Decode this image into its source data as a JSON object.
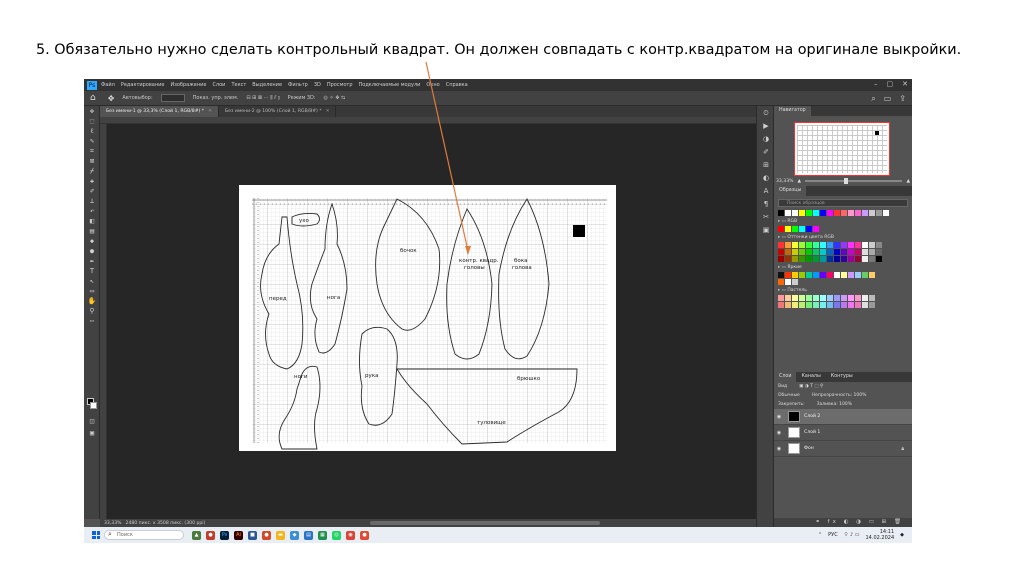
{
  "caption": "5. Обязательно нужно сделать контрольный квадрат. Он должен совпадать с контр.квадратом на оригинале выкройки.",
  "app": {
    "logo": "Ps",
    "menu": [
      "Файл",
      "Редактирование",
      "Изображение",
      "Слои",
      "Текст",
      "Выделение",
      "Фильтр",
      "3D",
      "Просмотр",
      "Подключаемые модули",
      "Окно",
      "Справка"
    ],
    "window_controls": [
      "–",
      "▢",
      "✕"
    ]
  },
  "options_bar": {
    "items": [
      "Автовыбор:",
      "Слой",
      "Показ. упр. элем."
    ],
    "mode_label": "Режим 3D:"
  },
  "doc_tabs": [
    {
      "label": "Без имени-1 @ 33,3% (Слой 1, RGB/8#) *",
      "active": true
    },
    {
      "label": "Без имени-2 @ 100% (Слой 1, RGB/8#) *",
      "active": false
    }
  ],
  "status": {
    "zoom": "33,33%",
    "doc": "2480 пикс. x 3508 пикс. (300 ppi)"
  },
  "panels": {
    "navigator": {
      "tabs": [
        "Навигатор"
      ],
      "zoom": "33,33%"
    },
    "swatches": {
      "tabs": [
        "Образцы"
      ],
      "search": "Поиск образцов",
      "groups": [
        "RGB",
        "Оттенки цвета RGB",
        "Яркие",
        "Пастель"
      ]
    },
    "layers": {
      "tabs": [
        "Слои",
        "Каналы",
        "Контуры"
      ],
      "kind_label": "Вид",
      "blend_mode": "Обычные",
      "opacity": "Непрозрачность: 100%",
      "lock_label": "Закрепить:",
      "fill": "Заливка: 100%",
      "rows": [
        {
          "name": "Слой 2",
          "selected": true,
          "thumb": "#000000"
        },
        {
          "name": "Слой 1",
          "selected": false,
          "thumb": "#ffffff"
        },
        {
          "name": "Фон",
          "selected": false,
          "thumb": "#ffffff",
          "locked": true
        }
      ]
    }
  },
  "pattern": {
    "labels": [
      "ухо",
      "перед",
      "нога",
      "ноги",
      "рука",
      "контр. квадр.",
      "бока",
      "бочок",
      "головы",
      "голова",
      "брюшко",
      "бок",
      "туловище"
    ]
  },
  "taskbar": {
    "search": "Поиск",
    "lang": "РУС",
    "time": "14:11",
    "date": "14.02.2024"
  },
  "colors": {
    "accent_ps": "#31a8ff",
    "arrow": "#e07b39",
    "canvas_bg": "#262626",
    "ui_dark": "#424242"
  }
}
